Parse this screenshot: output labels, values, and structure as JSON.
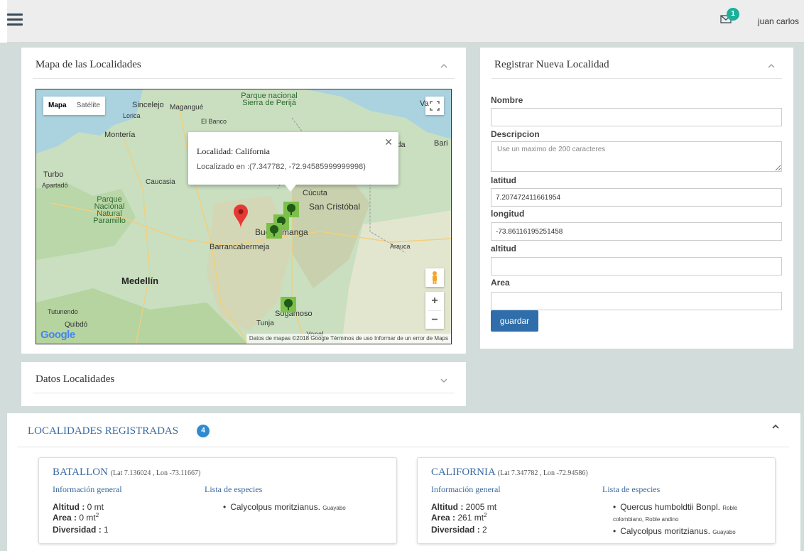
{
  "topbar": {
    "user_name": "juan carlos",
    "mail_count": "1"
  },
  "map_panel": {
    "title": "Mapa de las Localidades",
    "maptype_map": "Mapa",
    "maptype_satellite": "Satélite",
    "info_title": "Localidad: California",
    "info_coords": "Localizado en :(7.347782, -72.94585999999998)",
    "footer": "Datos de mapas ©2018 Google   Términos de uso   Informar de un error de Maps",
    "google": "Google",
    "labels": [
      "Sincelejo",
      "Magangué",
      "Lorica",
      "El Banco",
      "Montería",
      "Caucasia",
      "Turbo",
      "Apartadó",
      "Parque Nacional Natural Paramillo",
      "Parque nacional Sierra de Perijá",
      "Cúcuta",
      "San Cristóbal",
      "Barrancabermeja",
      "Medellín",
      "Bucaramanga",
      "Sogamoso",
      "Tunja",
      "Quibdó",
      "Tutunendo",
      "Arauca",
      "Yopal",
      "Bari",
      "ida",
      "Va"
    ]
  },
  "form_panel": {
    "title": "Registrar Nueva Localidad",
    "nombre_label": "Nombre",
    "descripcion_label": "Descripcion",
    "descripcion_placeholder": "Use un maximo de 200 caracteres",
    "latitud_label": "latitud",
    "latitud_value": "7.207472411661954",
    "longitud_label": "longitud",
    "longitud_value": "-73.86116195251458",
    "altitud_label": "altitud",
    "area_label": "Area",
    "save_label": "guardar"
  },
  "datos_panel": {
    "title": "Datos Localidades"
  },
  "localidades": {
    "title": "LOCALIDADES REGISTRADAS",
    "count": "4",
    "info_header": "Información general",
    "species_header": "Lista de especies",
    "altitud_key": "Altitud :",
    "area_key": "Area :",
    "diversidad_key": "Diversidad :",
    "cards": [
      {
        "name": "BATALLON",
        "coords": "(Lat 7.136024 , Lon -73.11667)",
        "altitud": "0 mt",
        "area": "0 mt",
        "diversidad": "1",
        "species": [
          {
            "name": "Calycolpus moritzianus.",
            "common": "Guayabo"
          }
        ]
      },
      {
        "name": "CALIFORNIA",
        "coords": "(Lat 7.347782 , Lon -72.94586)",
        "altitud": "2005 mt",
        "area": "261 mt",
        "diversidad": "2",
        "species": [
          {
            "name": "Quercus humboldtii Bonpl.",
            "common": "Roble colombiano, Roble andino"
          },
          {
            "name": "Calycolpus moritzianus.",
            "common": "Guayabo"
          }
        ]
      }
    ]
  },
  "colors": {
    "accent": "#2f6eaa",
    "badge_green": "#1caf9a",
    "title_blue": "#3b6aa0"
  }
}
